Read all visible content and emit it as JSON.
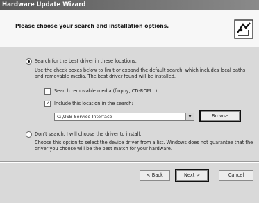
{
  "window": {
    "title": "Hardware Update Wizard"
  },
  "header": {
    "title": "Please choose your search and installation options.",
    "icon": "hardware-wizard-icon"
  },
  "search_option": {
    "label": "Search for the best driver in these locations.",
    "selected": true,
    "description": "Use the check boxes below to limit or expand the default search, which includes local paths and removable media. The best driver found will be installed.",
    "removable_media": {
      "label": "Search removable media (floppy, CD-ROM...)",
      "checked": false
    },
    "include_location": {
      "label": "Include this location in the search:",
      "checked": true
    },
    "location_value": "C:\\USB Service Interface",
    "browse_label": "Browse"
  },
  "manual_option": {
    "label": "Don't search. I will choose the driver to install.",
    "selected": false,
    "description": "Choose this option to select the device driver from a list. Windows does not guarantee that the driver you choose will be the best match for your hardware."
  },
  "footer": {
    "back_label": "< Back",
    "next_label": "Next >",
    "cancel_label": "Cancel"
  }
}
